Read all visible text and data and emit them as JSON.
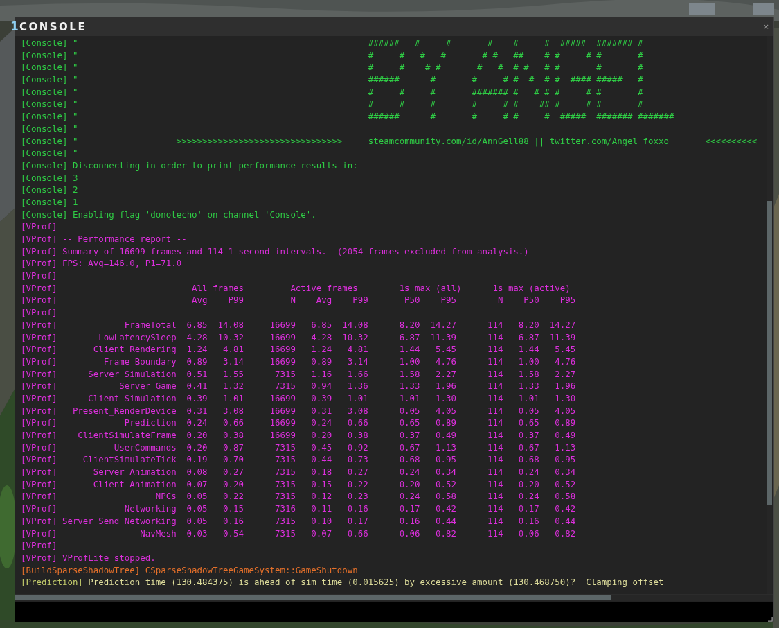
{
  "hud_digit": "1",
  "window": {
    "title": "CONSOLE",
    "close": "×"
  },
  "log": [
    {
      "kind": "console",
      "channel": "[Console]",
      "message": "\"                                                        ######   #     #       #    #     #  #####  ####### #"
    },
    {
      "kind": "console",
      "channel": "[Console]",
      "message": "\"                                                        #     #   #   #       # #   ##    # #     # #       #"
    },
    {
      "kind": "console",
      "channel": "[Console]",
      "message": "\"                                                        #     #    # #       #   #  # #   # #       #       #"
    },
    {
      "kind": "console",
      "channel": "[Console]",
      "message": "\"                                                        ######      #       #     # #  #  # #  #### #####   #"
    },
    {
      "kind": "console",
      "channel": "[Console]",
      "message": "\"                                                        #     #     #       ####### #   # # #     # #       #"
    },
    {
      "kind": "console",
      "channel": "[Console]",
      "message": "\"                                                        #     #     #       #     # #    ## #     # #       #"
    },
    {
      "kind": "console",
      "channel": "[Console]",
      "message": "\"                                                        ######      #       #     # #     #  #####  ####### #######"
    },
    {
      "kind": "console",
      "channel": "[Console]",
      "message": "\""
    },
    {
      "kind": "console",
      "channel": "[Console]",
      "message": "\"                   >>>>>>>>>>>>>>>>>>>>>>>>>>>>>>>>     steamcommunity.com/id/AnnGell88 || twitter.com/Angel_foxxo       <<<<<<<<<<"
    },
    {
      "kind": "console",
      "channel": "[Console]",
      "message": "\""
    },
    {
      "kind": "console",
      "channel": "[Console]",
      "message": "Disconnecting in order to print performance results in:"
    },
    {
      "kind": "console",
      "channel": "[Console]",
      "message": "3"
    },
    {
      "kind": "console",
      "channel": "[Console]",
      "message": "2"
    },
    {
      "kind": "console",
      "channel": "[Console]",
      "message": "1"
    },
    {
      "kind": "console",
      "channel": "[Console]",
      "message": "Enabling flag 'donotecho' on channel 'Console'."
    },
    {
      "kind": "vprof",
      "channel": "[VProf]"
    },
    {
      "kind": "vprof",
      "channel": "[VProf]",
      "message": "-- Performance report --"
    },
    {
      "kind": "vprof",
      "channel": "[VProf]",
      "message": "Summary of 16699 frames and 114 1-second intervals.  (2054 frames excluded from analysis.)"
    },
    {
      "kind": "vprof",
      "channel": "[VProf]",
      "message": "FPS: Avg=146.0, P1=71.0"
    },
    {
      "kind": "vprof",
      "channel": "[VProf]"
    },
    {
      "kind": "vprof_groups",
      "channel": "[VProf]",
      "cells": [
        "All frames",
        "Active frames",
        "1s max (all)",
        "1s max (active)"
      ]
    },
    {
      "kind": "vprof_columns",
      "channel": "[VProf]",
      "cells": [
        "Avg",
        "P99",
        "N",
        "Avg",
        "P99",
        "P50",
        "P95",
        "N",
        "P50",
        "P95"
      ]
    },
    {
      "kind": "vprof_rule",
      "channel": "[VProf]",
      "cells": [
        "----------------------",
        "------",
        "------",
        "------",
        "------",
        "------",
        "------",
        "------",
        "------",
        "------",
        "------"
      ]
    },
    {
      "kind": "vprof_row",
      "channel": "[VProf]",
      "name": "FrameTotal",
      "values": [
        "6.85",
        "14.08",
        "16699",
        "6.85",
        "14.08",
        "8.20",
        "14.27",
        "114",
        "8.20",
        "14.27"
      ]
    },
    {
      "kind": "vprof_row",
      "channel": "[VProf]",
      "name": "LowLatencySleep",
      "values": [
        "4.28",
        "10.32",
        "16699",
        "4.28",
        "10.32",
        "6.87",
        "11.39",
        "114",
        "6.87",
        "11.39"
      ]
    },
    {
      "kind": "vprof_row",
      "channel": "[VProf]",
      "name": "Client Rendering",
      "values": [
        "1.24",
        "4.81",
        "16699",
        "1.24",
        "4.81",
        "1.44",
        "5.45",
        "114",
        "1.44",
        "5.45"
      ]
    },
    {
      "kind": "vprof_row",
      "channel": "[VProf]",
      "name": "Frame Boundary",
      "values": [
        "0.89",
        "3.14",
        "16699",
        "0.89",
        "3.14",
        "1.00",
        "4.76",
        "114",
        "1.00",
        "4.76"
      ]
    },
    {
      "kind": "vprof_row",
      "channel": "[VProf]",
      "name": "Server Simulation",
      "values": [
        "0.51",
        "1.55",
        "7315",
        "1.16",
        "1.66",
        "1.58",
        "2.27",
        "114",
        "1.58",
        "2.27"
      ]
    },
    {
      "kind": "vprof_row",
      "channel": "[VProf]",
      "name": "Server Game",
      "values": [
        "0.41",
        "1.32",
        "7315",
        "0.94",
        "1.36",
        "1.33",
        "1.96",
        "114",
        "1.33",
        "1.96"
      ]
    },
    {
      "kind": "vprof_row",
      "channel": "[VProf]",
      "name": "Client Simulation",
      "values": [
        "0.39",
        "1.01",
        "16699",
        "0.39",
        "1.01",
        "1.01",
        "1.30",
        "114",
        "1.01",
        "1.30"
      ]
    },
    {
      "kind": "vprof_row",
      "channel": "[VProf]",
      "name": "Present_RenderDevice",
      "values": [
        "0.31",
        "3.08",
        "16699",
        "0.31",
        "3.08",
        "0.05",
        "4.05",
        "114",
        "0.05",
        "4.05"
      ]
    },
    {
      "kind": "vprof_row",
      "channel": "[VProf]",
      "name": "Prediction",
      "values": [
        "0.24",
        "0.66",
        "16699",
        "0.24",
        "0.66",
        "0.65",
        "0.89",
        "114",
        "0.65",
        "0.89"
      ]
    },
    {
      "kind": "vprof_row",
      "channel": "[VProf]",
      "name": "ClientSimulateFrame",
      "values": [
        "0.20",
        "0.38",
        "16699",
        "0.20",
        "0.38",
        "0.37",
        "0.49",
        "114",
        "0.37",
        "0.49"
      ]
    },
    {
      "kind": "vprof_row",
      "channel": "[VProf]",
      "name": "UserCommands",
      "values": [
        "0.20",
        "0.87",
        "7315",
        "0.45",
        "0.92",
        "0.67",
        "1.13",
        "114",
        "0.67",
        "1.13"
      ]
    },
    {
      "kind": "vprof_row",
      "channel": "[VProf]",
      "name": "ClientSimulateTick",
      "values": [
        "0.19",
        "0.70",
        "7315",
        "0.44",
        "0.73",
        "0.68",
        "0.95",
        "114",
        "0.68",
        "0.95"
      ]
    },
    {
      "kind": "vprof_row",
      "channel": "[VProf]",
      "name": "Server Animation",
      "values": [
        "0.08",
        "0.27",
        "7315",
        "0.18",
        "0.27",
        "0.24",
        "0.34",
        "114",
        "0.24",
        "0.34"
      ]
    },
    {
      "kind": "vprof_row",
      "channel": "[VProf]",
      "name": "Client_Animation",
      "values": [
        "0.07",
        "0.20",
        "7315",
        "0.15",
        "0.22",
        "0.20",
        "0.52",
        "114",
        "0.20",
        "0.52"
      ]
    },
    {
      "kind": "vprof_row",
      "channel": "[VProf]",
      "name": "NPCs",
      "values": [
        "0.05",
        "0.22",
        "7315",
        "0.12",
        "0.23",
        "0.24",
        "0.58",
        "114",
        "0.24",
        "0.58"
      ]
    },
    {
      "kind": "vprof_row",
      "channel": "[VProf]",
      "name": "Networking",
      "values": [
        "0.05",
        "0.15",
        "7316",
        "0.11",
        "0.16",
        "0.17",
        "0.42",
        "114",
        "0.17",
        "0.42"
      ]
    },
    {
      "kind": "vprof_row",
      "channel": "[VProf]",
      "name": "Server Send Networking",
      "values": [
        "0.05",
        "0.16",
        "7315",
        "0.10",
        "0.17",
        "0.16",
        "0.44",
        "114",
        "0.16",
        "0.44"
      ]
    },
    {
      "kind": "vprof_row",
      "channel": "[VProf]",
      "name": "NavMesh",
      "values": [
        "0.03",
        "0.54",
        "7315",
        "0.07",
        "0.66",
        "0.06",
        "0.82",
        "114",
        "0.06",
        "0.82"
      ]
    },
    {
      "kind": "vprof",
      "channel": "[VProf]"
    },
    {
      "kind": "vprof",
      "channel": "[VProf]",
      "message": "VProfLite stopped."
    },
    {
      "kind": "build",
      "channel": "[BuildSparseShadowTree]",
      "message": "CSparseShadowTreeGameSystem::GameShutdown"
    },
    {
      "kind": "prediction",
      "channel": "[Prediction]",
      "message": "Prediction time (130.484375) is ahead of sim time (0.015625) by excessive amount (130.468750)?  Clamping offset"
    }
  ]
}
